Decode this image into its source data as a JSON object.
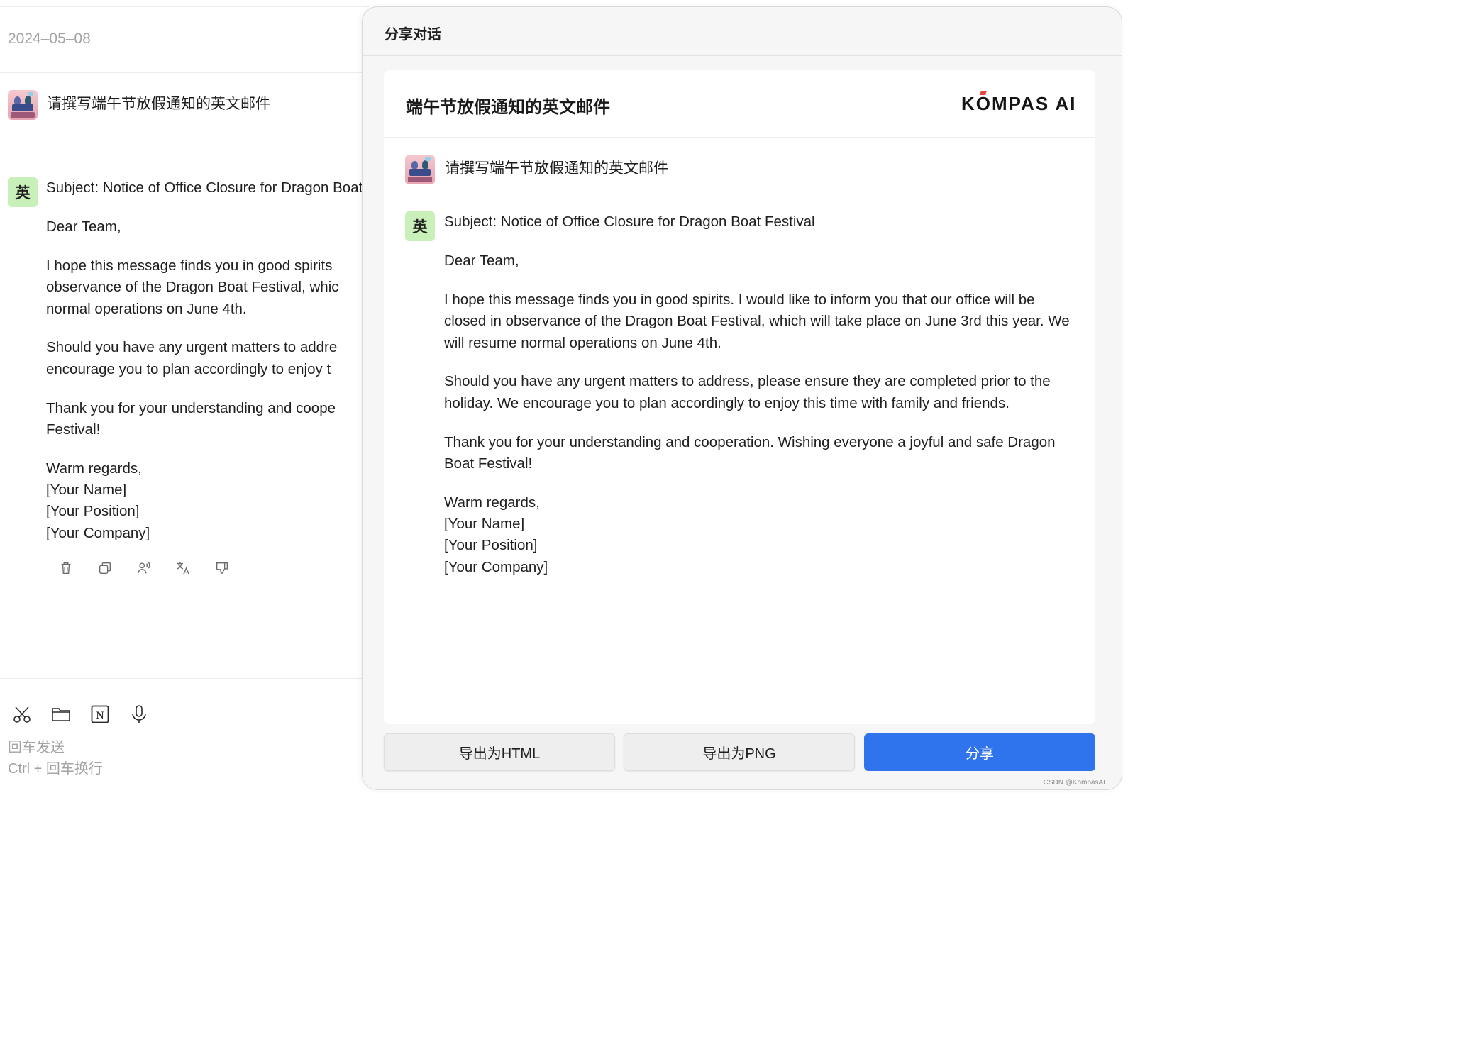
{
  "chat": {
    "date": "2024–05–08",
    "user_prompt": "请撰写端午节放假通知的英文邮件",
    "assistant_badge": "英",
    "reply": {
      "subject": "Subject: Notice of Office Closure for Dragon Boat Festival",
      "greeting": "Dear Team,",
      "para1": "I hope this message finds you in good spirits. I would like to inform you that our office will be closed in observance of the Dragon Boat Festival, which will take place on June 3rd this year. We will resume normal operations on June 4th.",
      "para2": "Should you have any urgent matters to address, please ensure they are completed prior to the holiday. We encourage you to plan accordingly to enjoy this time with family and friends.",
      "para3": "Thank you for your understanding and cooperation. Wishing everyone a joyful and safe Dragon Boat Festival!",
      "closing": "Warm regards,",
      "sig_name": "[Your Name]",
      "sig_position": "[Your Position]",
      "sig_company": "[Your Company]"
    },
    "left_lines": {
      "p1_l1": "I hope this message finds you in good spirits",
      "p1_l2": "observance of the Dragon Boat Festival, whic",
      "p1_l3": "normal operations on June 4th.",
      "p2_l1": "Should you have any urgent matters to addre",
      "p2_l2": "encourage you to plan accordingly to enjoy t",
      "p3_l1": "Thank you for your understanding and coope",
      "p3_l2": "Festival!"
    },
    "actions": [
      "trash-icon",
      "copy-icon",
      "speak-icon",
      "translate-icon",
      "thumbs-down-icon"
    ],
    "input_tools": [
      "scissors-icon",
      "folder-icon",
      "notion-icon",
      "microphone-icon"
    ],
    "hint_send": "回车发送",
    "hint_newline": "Ctrl + 回车换行"
  },
  "share_dialog": {
    "title": "分享对话",
    "card_title": "端午节放假通知的英文邮件",
    "logo_text": "KOMPAS AI",
    "buttons": {
      "export_html": "导出为HTML",
      "export_png": "导出为PNG",
      "share": "分享"
    }
  },
  "watermark": "CSDN @KompasAI",
  "colors": {
    "primary_button": "#2f74ec",
    "badge_bg": "#c9f0b8",
    "logo_accent": "#e5483e",
    "muted_text": "#a3a3a3"
  }
}
